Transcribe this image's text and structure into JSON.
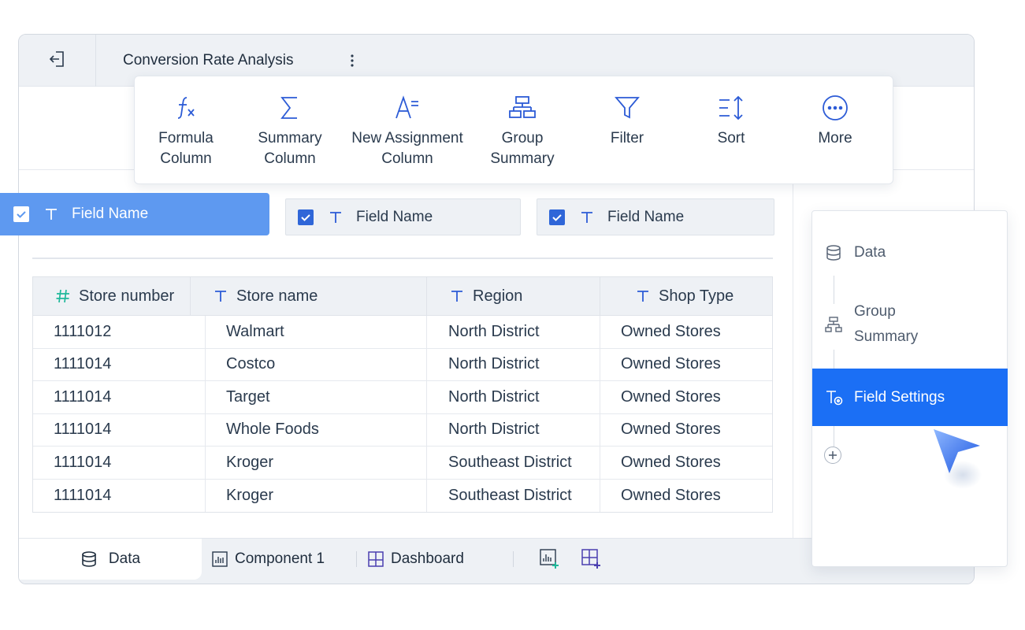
{
  "window": {
    "title": "Conversion Rate Analysis"
  },
  "toolbar": {
    "items": [
      {
        "icon": "formula-icon",
        "label": "Formula\nColumn"
      },
      {
        "icon": "sigma-icon",
        "label": "Summary\nColumn"
      },
      {
        "icon": "assignment-icon",
        "label": "New Assignment\nColumn"
      },
      {
        "icon": "hierarchy-icon",
        "label": "Group\nSummary"
      },
      {
        "icon": "filter-icon",
        "label": "Filter"
      },
      {
        "icon": "sort-icon",
        "label": "Sort"
      },
      {
        "icon": "more-icon",
        "label": "More"
      }
    ]
  },
  "fields": [
    {
      "label": "Field Name",
      "checked": true
    },
    {
      "label": "Field Name",
      "checked": true
    },
    {
      "label": "Field Name",
      "checked": true
    }
  ],
  "table": {
    "headers": [
      {
        "icon": "number-icon",
        "label": "Store number"
      },
      {
        "icon": "text-icon",
        "label": "Store name"
      },
      {
        "icon": "text-icon",
        "label": "Region"
      },
      {
        "icon": "text-icon",
        "label": "Shop Type"
      }
    ],
    "rows": [
      [
        "1111012",
        "Walmart",
        "North District",
        "Owned Stores"
      ],
      [
        "1111014",
        "Costco",
        "North District",
        "Owned Stores"
      ],
      [
        "1111014",
        "Target",
        "North District",
        "Owned Stores"
      ],
      [
        "1111014",
        "Whole Foods",
        "North District",
        "Owned Stores"
      ],
      [
        "1111014",
        "Kroger",
        "Southeast District",
        "Owned Stores"
      ],
      [
        "1111014",
        "Kroger",
        "Southeast District",
        "Owned Stores"
      ]
    ]
  },
  "side_panel": {
    "steps": [
      {
        "icon": "database-icon",
        "label": "Data",
        "active": false
      },
      {
        "icon": "hierarchy-icon",
        "label": "Group\nSummary",
        "active": false
      },
      {
        "icon": "field-settings-icon",
        "label": "Field Settings",
        "active": true
      }
    ]
  },
  "bottom_tabs": {
    "data_label": "Data",
    "component_label": "Component 1",
    "dashboard_label": "Dashboard"
  },
  "colors": {
    "accent": "#1b6ff5",
    "active_chip": "#5e99f0",
    "checkbox": "#2f66d8",
    "icon_blue": "#2c5bd6",
    "number_icon": "#1fb89a"
  }
}
